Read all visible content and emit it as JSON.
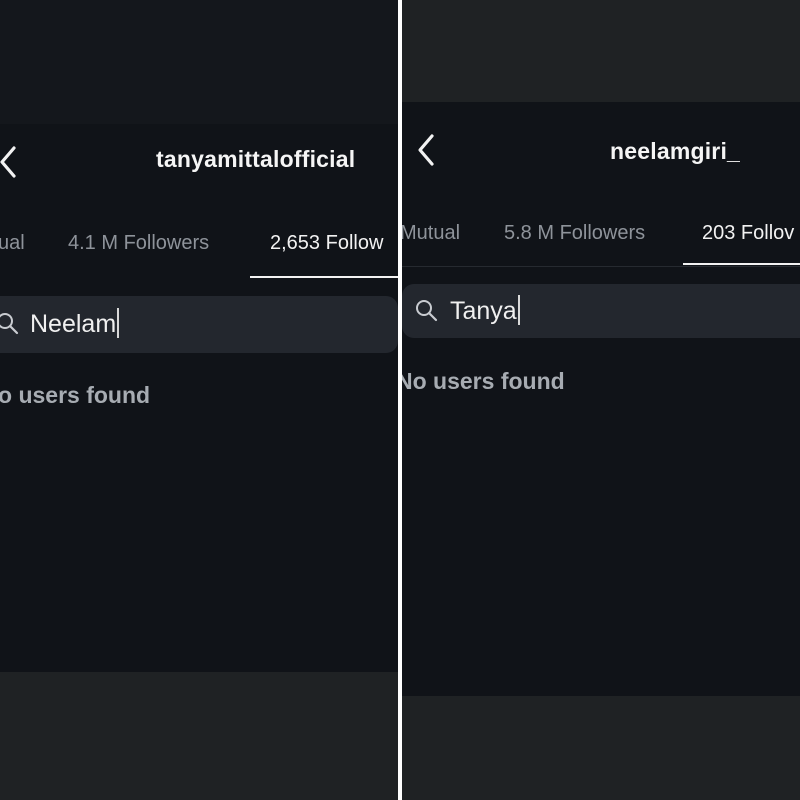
{
  "left": {
    "username": "tanyamittalofficial",
    "tabs": [
      {
        "label": "ual",
        "active": false
      },
      {
        "label": "4.1 M Followers",
        "active": false
      },
      {
        "label": "2,653 Follow",
        "active": true
      }
    ],
    "search": {
      "value": "Neelam"
    },
    "empty_message": "o users found"
  },
  "right": {
    "username": "neelamgiri_",
    "tabs": [
      {
        "label": "Mutual",
        "active": false
      },
      {
        "label": "5.8 M Followers",
        "active": false
      },
      {
        "label": "203 Follov",
        "active": true
      }
    ],
    "search": {
      "value": "Tanya"
    },
    "empty_message": "No users found"
  },
  "icons": {
    "back": "chevron-left-icon",
    "search": "search-icon"
  },
  "colors": {
    "screen_bg": "#101318",
    "search_bg": "#23272e",
    "active_tab": "#f2f2f2",
    "inactive_tab": "#8e939a"
  }
}
